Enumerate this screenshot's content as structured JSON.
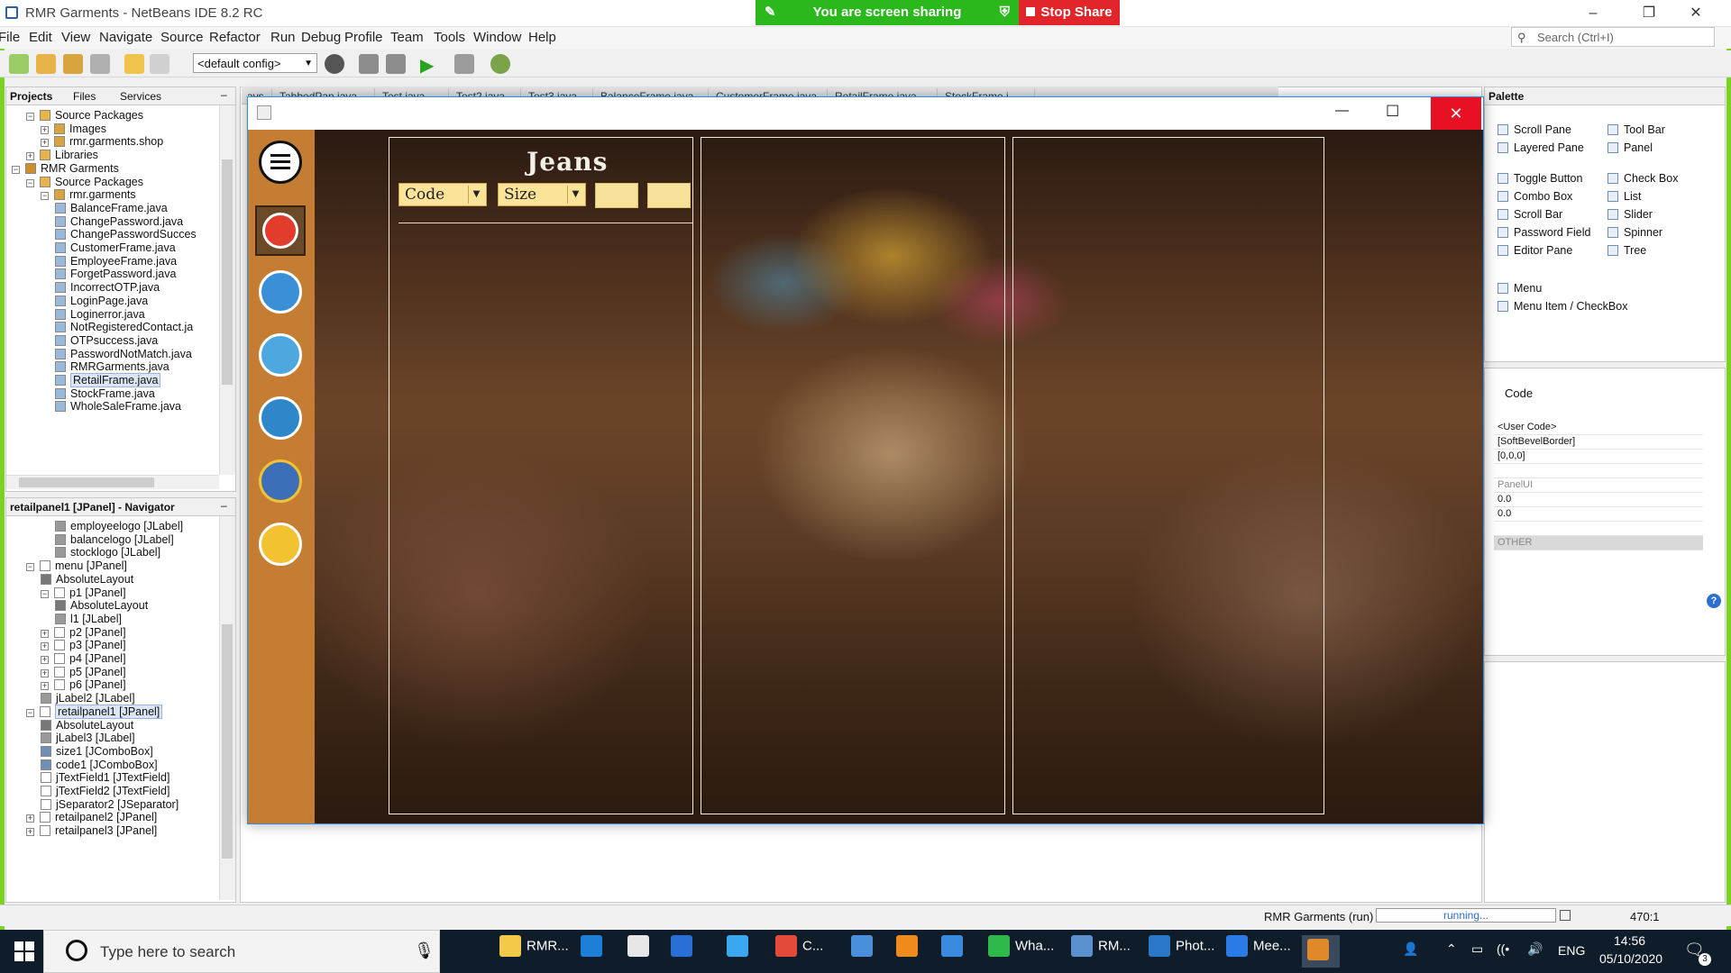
{
  "window": {
    "title": "RMR Garments - NetBeans IDE 8.2 RC",
    "minimize": "–",
    "restore": "❐",
    "close": "✕"
  },
  "share": {
    "status_text": "You are screen sharing",
    "stop_label": "Stop Share"
  },
  "menubar": {
    "items": [
      "File",
      "Edit",
      "View",
      "Navigate",
      "Source",
      "Refactor",
      "Run",
      "Debug",
      "Profile",
      "Team",
      "Tools",
      "Window",
      "Help"
    ],
    "search_placeholder": "Search (Ctrl+I)"
  },
  "toolbar": {
    "config": "<default config>"
  },
  "projects_panel": {
    "tabs": [
      "Projects",
      "Files",
      "Services"
    ],
    "minimize": "–",
    "tree": [
      {
        "label": "Source Packages",
        "indent": 1,
        "exp": "-",
        "icon": "folder"
      },
      {
        "label": "Images",
        "indent": 2,
        "exp": "+",
        "icon": "package"
      },
      {
        "label": "rmr.garments.shop",
        "indent": 2,
        "exp": "+",
        "icon": "package"
      },
      {
        "label": "Libraries",
        "indent": 1,
        "exp": "+",
        "icon": "folder"
      },
      {
        "label": "RMR Garments",
        "indent": 0,
        "exp": "-",
        "icon": "project"
      },
      {
        "label": "Source Packages",
        "indent": 1,
        "exp": "-",
        "icon": "folder"
      },
      {
        "label": "rmr.garments",
        "indent": 2,
        "exp": "-",
        "icon": "package"
      },
      {
        "label": "BalanceFrame.java",
        "indent": 3,
        "exp": "",
        "icon": "java"
      },
      {
        "label": "ChangePassword.java",
        "indent": 3,
        "exp": "",
        "icon": "java"
      },
      {
        "label": "ChangePasswordSucces",
        "indent": 3,
        "exp": "",
        "icon": "java"
      },
      {
        "label": "CustomerFrame.java",
        "indent": 3,
        "exp": "",
        "icon": "java"
      },
      {
        "label": "EmployeeFrame.java",
        "indent": 3,
        "exp": "",
        "icon": "java"
      },
      {
        "label": "ForgetPassword.java",
        "indent": 3,
        "exp": "",
        "icon": "java"
      },
      {
        "label": "IncorrectOTP.java",
        "indent": 3,
        "exp": "",
        "icon": "java"
      },
      {
        "label": "LoginPage.java",
        "indent": 3,
        "exp": "",
        "icon": "java"
      },
      {
        "label": "Loginerror.java",
        "indent": 3,
        "exp": "",
        "icon": "java"
      },
      {
        "label": "NotRegisteredContact.ja",
        "indent": 3,
        "exp": "",
        "icon": "java"
      },
      {
        "label": "OTPsuccess.java",
        "indent": 3,
        "exp": "",
        "icon": "java"
      },
      {
        "label": "PasswordNotMatch.java",
        "indent": 3,
        "exp": "",
        "icon": "java"
      },
      {
        "label": "RMRGarments.java",
        "indent": 3,
        "exp": "",
        "icon": "java"
      },
      {
        "label": "RetailFrame.java",
        "indent": 3,
        "exp": "",
        "icon": "java",
        "selected": true
      },
      {
        "label": "StockFrame.java",
        "indent": 3,
        "exp": "",
        "icon": "java"
      },
      {
        "label": "WholeSaleFrame.java",
        "indent": 3,
        "exp": "",
        "icon": "java"
      }
    ]
  },
  "navigator_panel": {
    "title": "retailpanel1 [JPanel] - Navigator",
    "minimize": "–",
    "tree": [
      {
        "label": "employeelogo [JLabel]",
        "indent": 3,
        "exp": "",
        "icon": "label"
      },
      {
        "label": "balancelogo [JLabel]",
        "indent": 3,
        "exp": "",
        "icon": "label"
      },
      {
        "label": "stocklogo [JLabel]",
        "indent": 3,
        "exp": "",
        "icon": "label"
      },
      {
        "label": "menu [JPanel]",
        "indent": 1,
        "exp": "-",
        "icon": "panel"
      },
      {
        "label": "AbsoluteLayout",
        "indent": 2,
        "exp": "",
        "icon": "layout"
      },
      {
        "label": "p1 [JPanel]",
        "indent": 2,
        "exp": "-",
        "icon": "panel"
      },
      {
        "label": "AbsoluteLayout",
        "indent": 3,
        "exp": "",
        "icon": "layout"
      },
      {
        "label": "l1 [JLabel]",
        "indent": 3,
        "exp": "",
        "icon": "label"
      },
      {
        "label": "p2 [JPanel]",
        "indent": 2,
        "exp": "+",
        "icon": "panel"
      },
      {
        "label": "p3 [JPanel]",
        "indent": 2,
        "exp": "+",
        "icon": "panel"
      },
      {
        "label": "p4 [JPanel]",
        "indent": 2,
        "exp": "+",
        "icon": "panel"
      },
      {
        "label": "p5 [JPanel]",
        "indent": 2,
        "exp": "+",
        "icon": "panel"
      },
      {
        "label": "p6 [JPanel]",
        "indent": 2,
        "exp": "+",
        "icon": "panel"
      },
      {
        "label": "jLabel2 [JLabel]",
        "indent": 2,
        "exp": "",
        "icon": "label"
      },
      {
        "label": "retailpanel1 [JPanel]",
        "indent": 1,
        "exp": "-",
        "icon": "panel",
        "selected": true
      },
      {
        "label": "AbsoluteLayout",
        "indent": 2,
        "exp": "",
        "icon": "layout"
      },
      {
        "label": "jLabel3 [JLabel]",
        "indent": 2,
        "exp": "",
        "icon": "label"
      },
      {
        "label": "size1 [JComboBox]",
        "indent": 2,
        "exp": "",
        "icon": "combo"
      },
      {
        "label": "code1 [JComboBox]",
        "indent": 2,
        "exp": "",
        "icon": "combo"
      },
      {
        "label": "jTextField1 [JTextField]",
        "indent": 2,
        "exp": "",
        "icon": "text"
      },
      {
        "label": "jTextField2 [JTextField]",
        "indent": 2,
        "exp": "",
        "icon": "text"
      },
      {
        "label": "jSeparator2 [JSeparator]",
        "indent": 2,
        "exp": "",
        "icon": "sep"
      },
      {
        "label": "retailpanel2 [JPanel]",
        "indent": 1,
        "exp": "+",
        "icon": "panel"
      },
      {
        "label": "retailpanel3 [JPanel]",
        "indent": 1,
        "exp": "+",
        "icon": "panel"
      }
    ]
  },
  "editor_tabs": [
    "avs",
    "TabbedPan.java",
    "Test.java",
    "Test2.java",
    "Test3.java",
    "BalanceFrame.java",
    "CustomerFrame.java",
    "RetailFrame.java",
    "StockFrame.j"
  ],
  "palette": {
    "title": "Palette",
    "items": [
      {
        "label": "Scroll Pane",
        "col": 0,
        "row": 0
      },
      {
        "label": "Tool Bar",
        "col": 1,
        "row": 0
      },
      {
        "label": "Layered Pane",
        "col": 0,
        "row": 1
      },
      {
        "label": "Panel",
        "col": 1,
        "row": 1
      },
      {
        "label": "Toggle Button",
        "col": 0,
        "row": 2
      },
      {
        "label": "Check Box",
        "col": 1,
        "row": 2
      },
      {
        "label": "Combo Box",
        "col": 0,
        "row": 3
      },
      {
        "label": "List",
        "col": 1,
        "row": 3
      },
      {
        "label": "Scroll Bar",
        "col": 0,
        "row": 4
      },
      {
        "label": "Slider",
        "col": 1,
        "row": 4
      },
      {
        "label": "Password Field",
        "col": 0,
        "row": 5
      },
      {
        "label": "Spinner",
        "col": 1,
        "row": 5
      },
      {
        "label": "Editor Pane",
        "col": 0,
        "row": 6
      },
      {
        "label": "Tree",
        "col": 1,
        "row": 6
      },
      {
        "label": "Menu",
        "col": 0,
        "row": 7
      },
      {
        "label": "Menu Item / CheckBox",
        "col": 0,
        "row": 8
      }
    ]
  },
  "properties": {
    "tab": "Code",
    "rows": [
      "<User Code>",
      "[SoftBevelBorder]",
      "[0,0,0]",
      "",
      "PanelUI",
      "0.0",
      "0.0",
      "",
      "OTHER"
    ],
    "help": "?"
  },
  "running_app": {
    "title": "Jeans",
    "code_combo": "Code",
    "size_combo": "Size",
    "minimize": "—",
    "maximize": "☐",
    "close": "✕",
    "side_icons": [
      "menu-icon",
      "retail-icon",
      "wholesale-icon",
      "customer-icon",
      "employee-icon",
      "stock-icon",
      "balance-icon"
    ]
  },
  "statusbar": {
    "run_label": "RMR Garments (run)",
    "progress_text": "running...",
    "position": "470:1"
  },
  "taskbar": {
    "search_placeholder": "Type here to search",
    "apps": [
      "RMR...",
      "",
      "",
      "",
      "",
      "C...",
      "",
      "",
      "",
      "Wha...",
      "RM...",
      "Phot...",
      "Mee...",
      ""
    ],
    "language": "ENG",
    "time": "14:56",
    "date": "05/10/2020",
    "notification_count": "3"
  },
  "colors": {
    "share_green": "#2bb81d",
    "share_red": "#e0262b",
    "app_side": "#c57d33",
    "field_yellow": "#fbe39a",
    "window_close_red": "#e81123"
  }
}
